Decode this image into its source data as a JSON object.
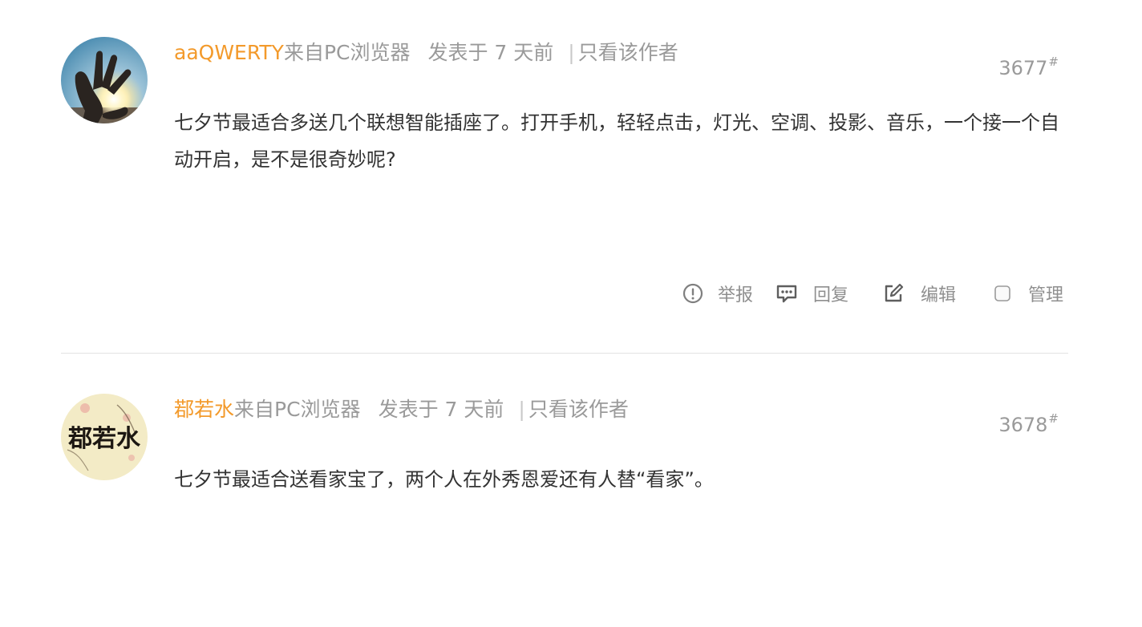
{
  "posts": [
    {
      "author": "aaQWERTY",
      "source": "来自PC浏览器",
      "posted": "发表于 7 天前",
      "separator": "|",
      "only_author": "只看该作者",
      "floor": "3677",
      "floor_mark": "#",
      "content": "七夕节最适合多送几个联想智能插座了。打开手机，轻轻点击，灯光、空调、投影、音乐，一个接一个自动开启，是不是很奇妙呢?",
      "actions": {
        "report": "举报",
        "reply": "回复",
        "edit": "编辑",
        "manage": "管理"
      }
    },
    {
      "author": "鄀若水",
      "source": "来自PC浏览器",
      "posted": "发表于 7 天前",
      "separator": "|",
      "only_author": "只看该作者",
      "floor": "3678",
      "floor_mark": "#",
      "content": "七夕节最适合送看家宝了，两个人在外秀恩爱还有人替“看家”。",
      "avatar_calligraphy": "鄀若水"
    }
  ],
  "icons": {
    "report": "exclamation-circle-icon",
    "reply": "comment-dots-icon",
    "edit": "pencil-square-icon",
    "manage": "checkbox-icon"
  },
  "colors": {
    "author": "#f39a2b",
    "meta": "#9a9a9a",
    "content": "#333333",
    "divider": "#e3e3e3"
  }
}
